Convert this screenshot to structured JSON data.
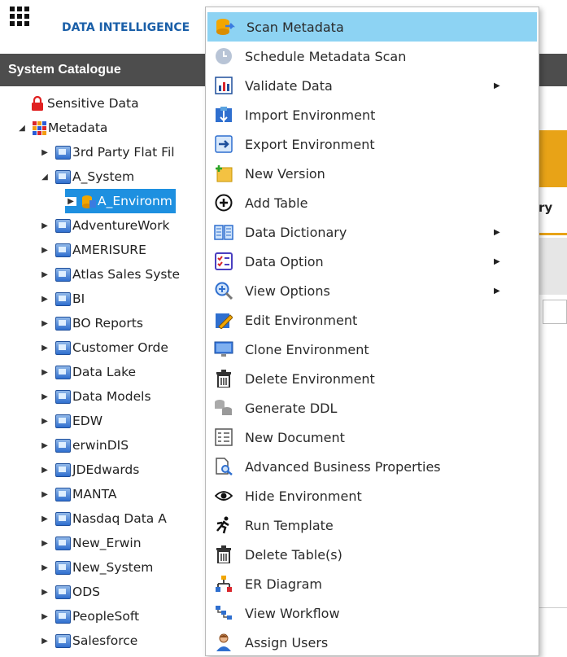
{
  "header": {
    "brand": "DATA INTELLIGENCE"
  },
  "panel": {
    "title": "System Catalogue"
  },
  "right_panel": {
    "tab_label": "ry"
  },
  "tree": {
    "sensitive": "Sensitive Data",
    "metadata": "Metadata",
    "items": [
      "3rd Party Flat Fil",
      "A_System",
      "A_Environm",
      "AdventureWork",
      "AMERISURE",
      "Atlas Sales Syste",
      "BI",
      "BO Reports",
      "Customer Orde",
      "Data Lake",
      "Data Models",
      "EDW",
      "erwinDIS",
      "JDEdwards",
      "MANTA",
      "Nasdaq Data A",
      "New_Erwin",
      "New_System",
      "ODS",
      "PeopleSoft",
      "Salesforce"
    ]
  },
  "menu": {
    "items": [
      {
        "label": "Scan Metadata",
        "icon": "scan-metadata-icon",
        "submenu": false,
        "highlighted": true
      },
      {
        "label": "Schedule Metadata Scan",
        "icon": "clock-icon",
        "submenu": false
      },
      {
        "label": "Validate Data",
        "icon": "bar-chart-icon",
        "submenu": true
      },
      {
        "label": "Import Environment",
        "icon": "import-icon",
        "submenu": false
      },
      {
        "label": "Export Environment",
        "icon": "export-icon",
        "submenu": false
      },
      {
        "label": "New Version",
        "icon": "new-version-icon",
        "submenu": false
      },
      {
        "label": "Add Table",
        "icon": "plus-circle-icon",
        "submenu": false
      },
      {
        "label": "Data Dictionary",
        "icon": "book-icon",
        "submenu": true
      },
      {
        "label": "Data Option",
        "icon": "checklist-icon",
        "submenu": true
      },
      {
        "label": "View Options",
        "icon": "magnifier-icon",
        "submenu": true
      },
      {
        "label": "Edit Environment",
        "icon": "pencil-icon",
        "submenu": false
      },
      {
        "label": "Clone Environment",
        "icon": "monitor-icon",
        "submenu": false
      },
      {
        "label": "Delete Environment",
        "icon": "trash-icon",
        "submenu": false
      },
      {
        "label": "Generate DDL",
        "icon": "database-icon",
        "submenu": false
      },
      {
        "label": "New Document",
        "icon": "document-icon",
        "submenu": false
      },
      {
        "label": "Advanced Business Properties",
        "icon": "doc-search-icon",
        "submenu": false
      },
      {
        "label": "Hide Environment",
        "icon": "eye-icon",
        "submenu": false
      },
      {
        "label": "Run Template",
        "icon": "runner-icon",
        "submenu": false
      },
      {
        "label": "Delete Table(s)",
        "icon": "trash-icon",
        "submenu": false
      },
      {
        "label": "ER Diagram",
        "icon": "hierarchy-icon",
        "submenu": false
      },
      {
        "label": "View Workflow",
        "icon": "workflow-icon",
        "submenu": false
      },
      {
        "label": "Assign Users",
        "icon": "user-icon",
        "submenu": false
      }
    ]
  },
  "colors": {
    "highlight": "#8dd3f3",
    "header": "#4d4d4d",
    "accent": "#e8a317",
    "brand": "#1a5fa8"
  }
}
